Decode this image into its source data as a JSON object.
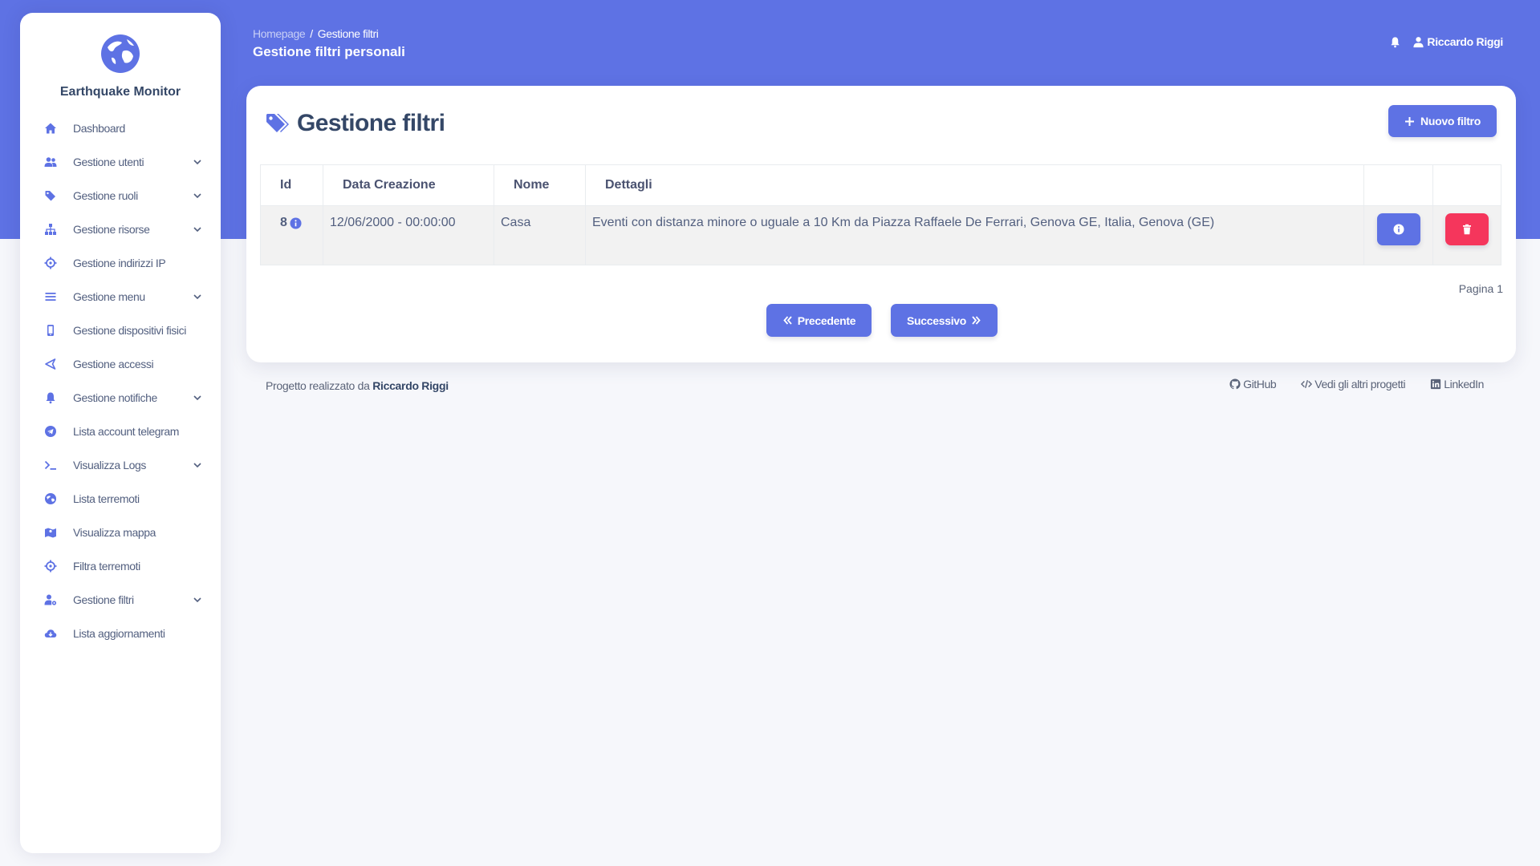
{
  "app": {
    "name": "Earthquake Monitor"
  },
  "colors": {
    "primary": "#5e72e4",
    "danger": "#f5365c",
    "background": "#f6f7fb"
  },
  "sidebar": {
    "items": [
      {
        "label": "Dashboard",
        "icon": "home-icon",
        "expandable": false
      },
      {
        "label": "Gestione utenti",
        "icon": "users-icon",
        "expandable": true
      },
      {
        "label": "Gestione ruoli",
        "icon": "tag-icon",
        "expandable": true
      },
      {
        "label": "Gestione risorse",
        "icon": "sitemap-icon",
        "expandable": true
      },
      {
        "label": "Gestione indirizzi IP",
        "icon": "crosshairs-icon",
        "expandable": false
      },
      {
        "label": "Gestione menu",
        "icon": "bars-icon",
        "expandable": true
      },
      {
        "label": "Gestione dispositivi fisici",
        "icon": "mobile-icon",
        "expandable": false
      },
      {
        "label": "Gestione accessi",
        "icon": "satellite-dish-icon",
        "expandable": false
      },
      {
        "label": "Gestione notifiche",
        "icon": "bell-icon",
        "expandable": true
      },
      {
        "label": "Lista account telegram",
        "icon": "telegram-icon",
        "expandable": false
      },
      {
        "label": "Visualizza Logs",
        "icon": "terminal-icon",
        "expandable": true
      },
      {
        "label": "Lista terremoti",
        "icon": "globe-icon",
        "expandable": false
      },
      {
        "label": "Visualizza mappa",
        "icon": "map-icon",
        "expandable": false
      },
      {
        "label": "Filtra terremoti",
        "icon": "crosshairs-icon",
        "expandable": false
      },
      {
        "label": "Gestione filtri",
        "icon": "user-cog-icon",
        "expandable": true
      },
      {
        "label": "Lista aggiornamenti",
        "icon": "cloud-download-icon",
        "expandable": false
      }
    ]
  },
  "header": {
    "breadcrumb": {
      "home": "Homepage",
      "separator": "/",
      "current": "Gestione filtri"
    },
    "subtitle": "Gestione filtri personali",
    "user_name": "Riccardo Riggi"
  },
  "main": {
    "title": "Gestione filtri",
    "new_button": "Nuovo filtro",
    "table": {
      "columns": [
        "Id",
        "Data Creazione",
        "Nome",
        "Dettagli",
        "",
        ""
      ],
      "rows": [
        {
          "id": "8",
          "date": "12/06/2000 - 00:00:00",
          "name": "Casa",
          "details": "Eventi con distanza minore o uguale a 10 Km da Piazza Raffaele De Ferrari, Genova GE, Italia, Genova (GE)"
        }
      ]
    },
    "page_info": "Pagina 1",
    "prev_button": "Precedente",
    "next_button": "Successivo"
  },
  "footer": {
    "credit_prefix": "Progetto realizzato da",
    "credit_name": "Riccardo Riggi",
    "links": {
      "github": "GitHub",
      "projects": "Vedi gli altri progetti",
      "linkedin": "LinkedIn"
    }
  }
}
